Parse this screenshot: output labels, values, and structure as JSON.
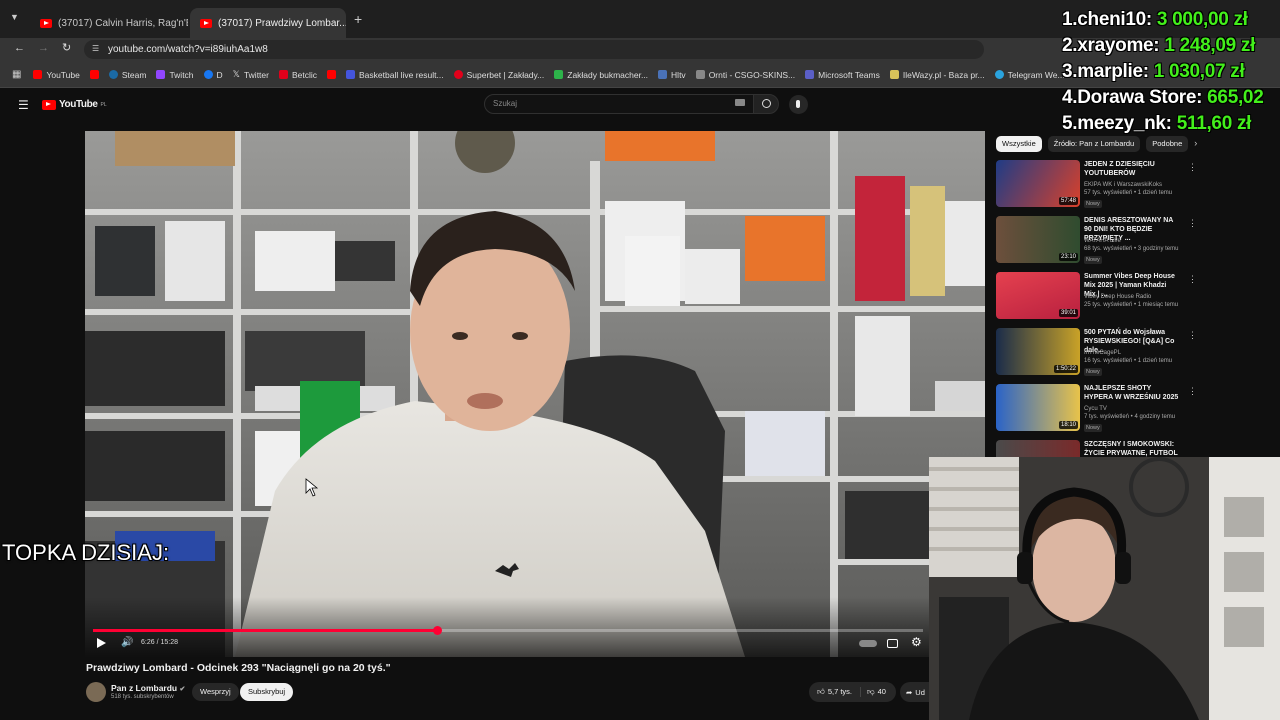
{
  "browser": {
    "tabs": [
      {
        "label": "(37017) Calvin Harris, Rag'n'Bo..."
      },
      {
        "label": "(37017) Prawdziwy Lombar..."
      }
    ],
    "new_tab_label": "+",
    "url": "youtube.com/watch?v=i89iuhAa1w8",
    "bookmarks": [
      {
        "label": "YouTube",
        "color": "#ff0000"
      },
      {
        "label": "",
        "color": "#ff0000"
      },
      {
        "label": "Steam",
        "color": "#1b6aa5"
      },
      {
        "label": "Twitch",
        "color": "#9146ff"
      },
      {
        "label": "D",
        "color": "#1877f2"
      },
      {
        "label": "Twitter",
        "color": "#cccccc"
      },
      {
        "label": "Betclic",
        "color": "#e0001b"
      },
      {
        "label": "",
        "color": "#ff0000"
      },
      {
        "label": "Basketball live result...",
        "color": "#4455dd"
      },
      {
        "label": "Superbet | Zakłady...",
        "color": "#e1001a"
      },
      {
        "label": "Zakłady bukmacher...",
        "color": "#2db34a"
      },
      {
        "label": "Hltv",
        "color": "#4a72b8"
      },
      {
        "label": "Ornti - CSGO-SKINS...",
        "color": "#888888"
      },
      {
        "label": "Microsoft Teams",
        "color": "#5b5fc7"
      },
      {
        "label": "IleWazy.pl - Baza pr...",
        "color": "#d8c25a"
      },
      {
        "label": "Telegram We...",
        "color": "#2aa3de"
      }
    ]
  },
  "youtube": {
    "logo": "YouTube",
    "region": "PL",
    "search_placeholder": "Szukaj",
    "video": {
      "title": "Prawdziwy Lombard - Odcinek 293 \"Naciągnęli go na 20 tyś.\"",
      "time_display": "6:26 / 15:28",
      "progress": 0.4148
    },
    "channel": {
      "name": "Pan z Lombardu",
      "subscribers": "518 tys. subskrybentów",
      "support_label": "Wesprzyj",
      "subscribe_label": "Subskrybuj"
    },
    "likes": "5,7 tys.",
    "dislikes": "40",
    "share_label": "Ud",
    "chips": [
      "Wszystkie",
      "Źródło: Pan z Lombardu",
      "Podobne"
    ],
    "recommended": [
      {
        "title": "JEDEN Z DZIESIĘCIU YOUTUBERÓW",
        "channel": "EKIPA WK i WarszawskiKoks",
        "views": "57 tys. wyświetleń • 1 dzień temu",
        "new": "Nowy",
        "duration": "57:48"
      },
      {
        "title": "DENIS ARESZTOWANY NA 90 DNI! KTO BĘDZIE PRZYPIĘTY ...",
        "channel": "WATAHA Live",
        "views": "68 tys. wyświetleń • 3 godziny temu",
        "new": "Nowy",
        "duration": "23:10"
      },
      {
        "title": "Summer Vibes Deep House Mix 2025 | Yaman Khadzi Mix | ...",
        "channel": "Vibey Deep House Radio",
        "views": "25 tys. wyświetleń • 1 miesiąc temu",
        "new": "",
        "duration": "39:01"
      },
      {
        "title": "500 PYTAŃ do Wojsława RYSIEWSKIEGO! [Q&A] Co dale...",
        "channel": "InTheCagePL",
        "views": "16 tys. wyświetleń • 1 dzień temu",
        "new": "Nowy",
        "duration": "1:50:22"
      },
      {
        "title": "NAJLEPSZE SHOTY HYPERA W WRZEŚNIU 2025",
        "channel": "Cycu TV",
        "views": "7 tys. wyświetleń • 4 godziny temu",
        "new": "Nowy",
        "duration": "18:10"
      },
      {
        "title": "SZCZĘSNY I SMOKOWSKI: ŻYCIE PRYWATNE, FUTBOL",
        "channel": "",
        "views": "",
        "new": "",
        "duration": ""
      }
    ]
  },
  "stream": {
    "leaderboard": [
      {
        "rank": "1.",
        "name": "cheni10:",
        "amount": "3 000,00 zł"
      },
      {
        "rank": "2.",
        "name": "xrayome:",
        "amount": "1 248,09 zł"
      },
      {
        "rank": "3.",
        "name": "marplie:",
        "amount": "1 030,07 zł"
      },
      {
        "rank": "4.",
        "name": "Dorawa Store:",
        "amount": "665,02"
      },
      {
        "rank": "5.",
        "name": "meezy_nk:",
        "amount": "511,60 zł"
      }
    ],
    "overlay_text": "TOPKA DZISIAJ:"
  },
  "colors": {
    "accent": "#ff0033",
    "donation": "#43ef1b"
  }
}
